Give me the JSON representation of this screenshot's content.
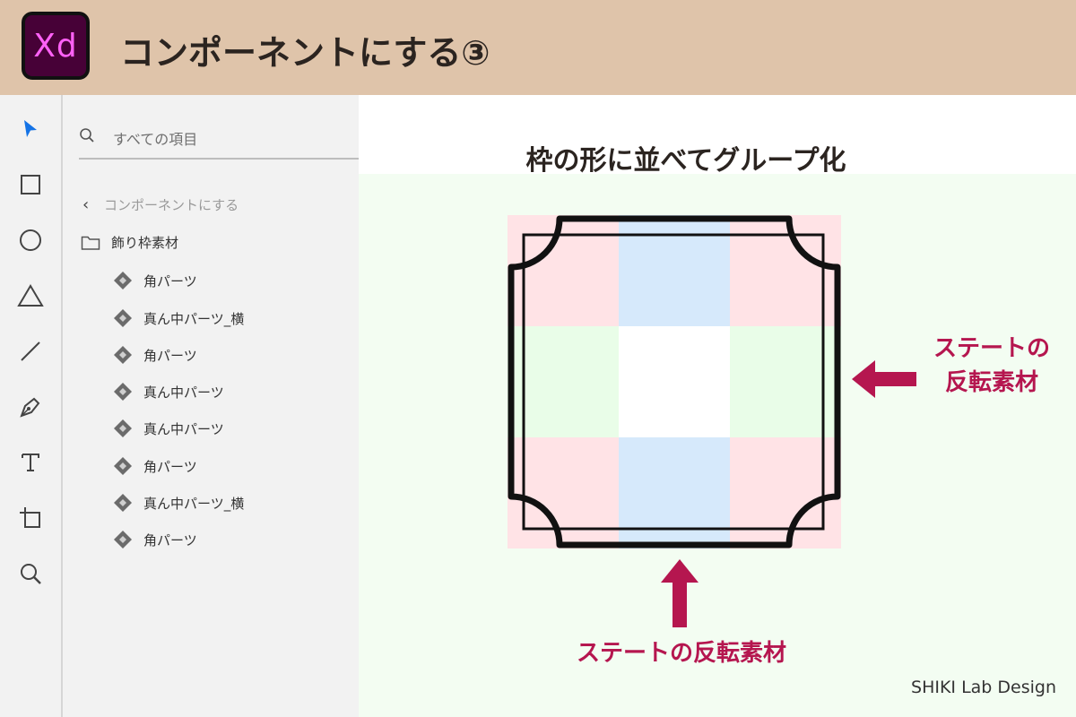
{
  "header": {
    "logo_text": "Xd",
    "title": "コンポーネントにする③",
    "background": "#dfc4aa"
  },
  "toolbar": {
    "tools": [
      "select-tool",
      "rectangle-tool",
      "ellipse-tool",
      "triangle-tool",
      "line-tool",
      "pen-tool",
      "text-tool",
      "artboard-tool",
      "zoom-tool"
    ]
  },
  "layers": {
    "search_placeholder": "すべての項目",
    "back_label": "コンポーネントにする",
    "folder_label": "飾り枠素材",
    "items": [
      {
        "label": "角パーツ"
      },
      {
        "label": "真ん中パーツ_横"
      },
      {
        "label": "角パーツ"
      },
      {
        "label": "真ん中パーツ"
      },
      {
        "label": "真ん中パーツ"
      },
      {
        "label": "角パーツ"
      },
      {
        "label": "真ん中パーツ_横"
      },
      {
        "label": "角パーツ"
      }
    ]
  },
  "canvas": {
    "title": "枠の形に並べてグループ化",
    "side_label_line1": "ステートの",
    "side_label_line2": "反転素材",
    "bottom_label": "ステートの反転素材",
    "credit": "SHIKI Lab Design",
    "colors": {
      "accent": "#b5164f",
      "corner": "#ffe3e6",
      "middle_horizontal": "#d6e9fb",
      "middle_vertical": "#e9fde8",
      "background": "#f3fdf2"
    }
  }
}
